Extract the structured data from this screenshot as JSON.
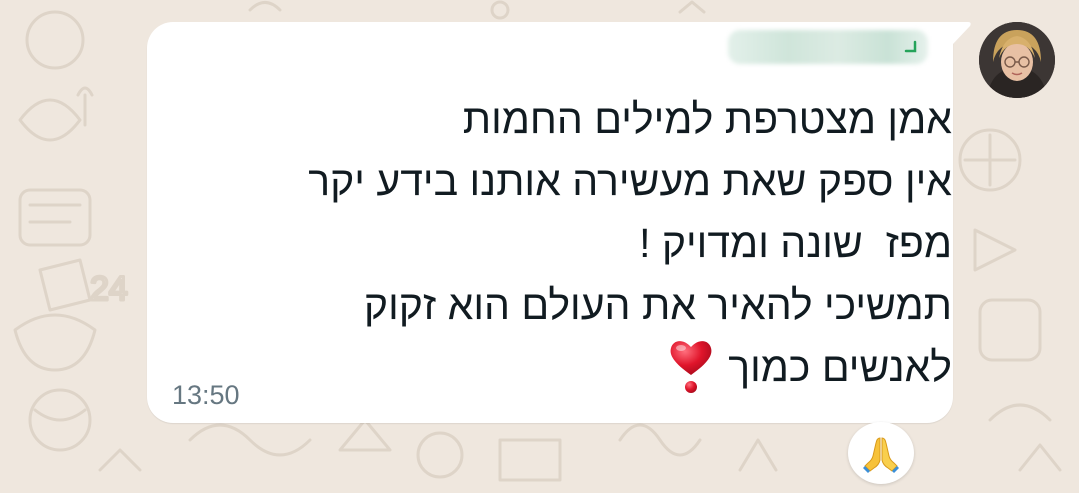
{
  "message": {
    "sender_name": "",
    "lines": [
      "אמן מצטרפת למילים החמות",
      "אין ספק שאת מעשירה אותנו בידע יקר",
      "מפז  שונה ומדויק !",
      "תמשיכי להאיר את העולם הוא זקוק",
      "לאנשים כמוך"
    ],
    "time": "13:50",
    "reaction_emoji_name": "folded-hands",
    "inline_emoji_name": "heavy-heart-exclamation"
  },
  "colors": {
    "wallpaper": "#efe7de",
    "bubble": "#ffffff",
    "text": "#111b21",
    "timestamp": "#667781",
    "accent_green": "#25a35a",
    "heart_red": "#e0152b"
  }
}
